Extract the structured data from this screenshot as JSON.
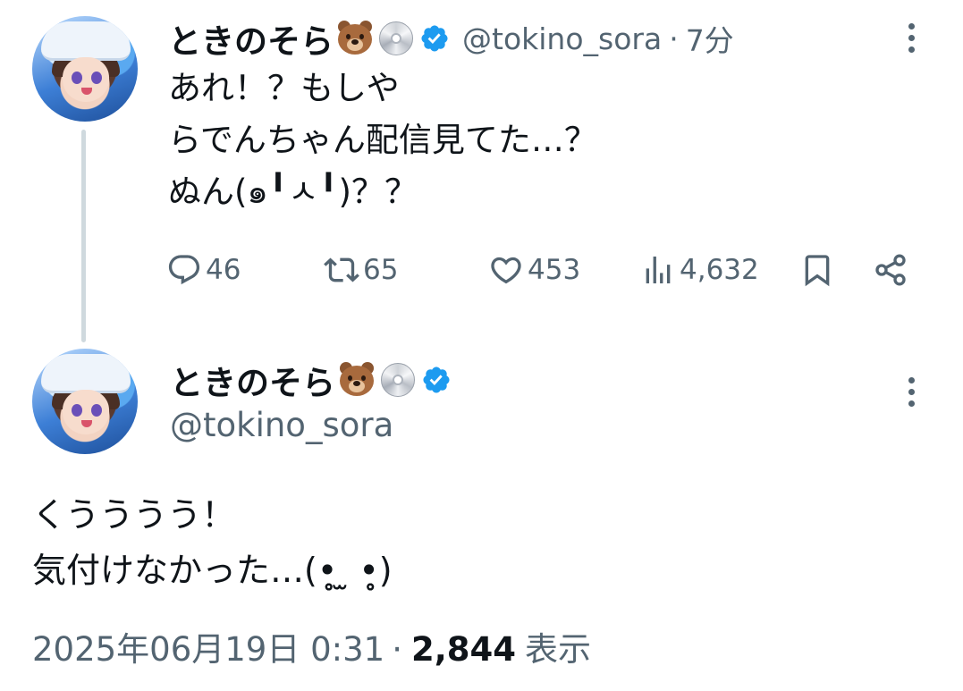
{
  "reply_tweet": {
    "display_name": "ときのそら",
    "name_emojis": [
      "bear-emoji",
      "disc-emoji"
    ],
    "handle": "@tokino_sora",
    "separator": "·",
    "time": "7分",
    "text": "あれ！？もしや\nらでんちゃん配信見てた…？\nぬん(๑╹ㅅ╹)？？",
    "stats": {
      "replies": "46",
      "retweets": "65",
      "likes": "453",
      "views": "4,632"
    }
  },
  "main_tweet": {
    "display_name": "ときのそら",
    "name_emojis": [
      "bear-emoji",
      "disc-emoji"
    ],
    "handle": "@tokino_sora",
    "text": "くうううう！\n気付けなかった…(•̥̥̥ ̫ •̥̥̥)",
    "timestamp": "2025年06月19日 0:31",
    "separator": "·",
    "views": "2,844",
    "views_label": "表示"
  },
  "colors": {
    "text_primary": "#0f1419",
    "text_secondary": "#536471",
    "verified_blue": "#1d9bf0",
    "thread_line": "#cfd9de"
  }
}
